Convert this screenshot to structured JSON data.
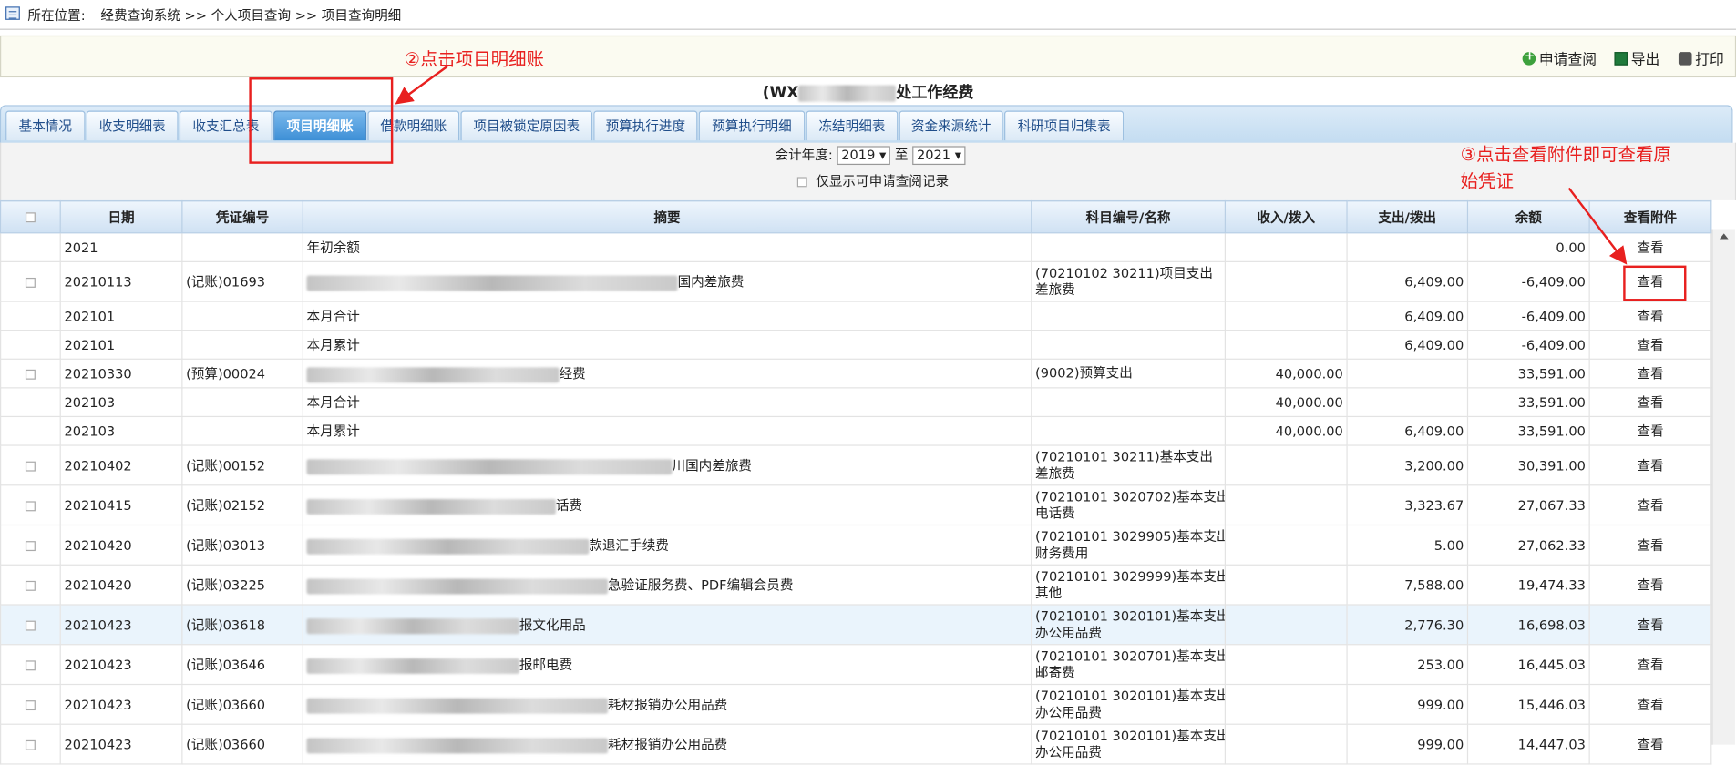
{
  "breadcrumb": {
    "label": "所在位置:",
    "path": "经费查询系统 >> 个人项目查询 >> 项目查询明细"
  },
  "toolbar": {
    "apply": "申请查阅",
    "export": "导出",
    "print": "打印"
  },
  "project_title": {
    "prefix": "(WX",
    "suffix": "处工作经费"
  },
  "tabs": [
    "基本情况",
    "收支明细表",
    "收支汇总表",
    "项目明细账",
    "借款明细账",
    "项目被锁定原因表",
    "预算执行进度",
    "预算执行明细",
    "冻结明细表",
    "资金来源统计",
    "科研项目归集表"
  ],
  "active_tab": "项目明细账",
  "filter": {
    "year_label": "会计年度:",
    "from": "2019",
    "to_label": "至",
    "to": "2021",
    "only_applicable": "仅显示可申请查阅记录"
  },
  "columns": [
    "日期",
    "凭证编号",
    "摘要",
    "科目编号/名称",
    "收入/拨入",
    "支出/拨出",
    "余额",
    "查看附件"
  ],
  "view_label": "查看",
  "rows": [
    {
      "date": "2021",
      "voucher": "",
      "summary": "年初余额",
      "subject": "",
      "income": "",
      "expense": "",
      "balance": "0.00",
      "check": false
    },
    {
      "date": "20210113",
      "voucher": "(记账)01693",
      "summary": "国内差旅费",
      "subject": "(70210102 30211)项目支出\n差旅费",
      "income": "",
      "expense": "6,409.00",
      "balance": "-6,409.00",
      "check": true
    },
    {
      "date": "202101",
      "voucher": "",
      "summary": "本月合计",
      "subject": "",
      "income": "",
      "expense": "6,409.00",
      "balance": "-6,409.00",
      "check": false
    },
    {
      "date": "202101",
      "voucher": "",
      "summary": "本月累计",
      "subject": "",
      "income": "",
      "expense": "6,409.00",
      "balance": "-6,409.00",
      "check": false
    },
    {
      "date": "20210330",
      "voucher": "(预算)00024",
      "summary": "经费",
      "subject": "(9002)预算支出",
      "income": "40,000.00",
      "expense": "",
      "balance": "33,591.00",
      "check": true
    },
    {
      "date": "202103",
      "voucher": "",
      "summary": "本月合计",
      "subject": "",
      "income": "40,000.00",
      "expense": "",
      "balance": "33,591.00",
      "check": false
    },
    {
      "date": "202103",
      "voucher": "",
      "summary": "本月累计",
      "subject": "",
      "income": "40,000.00",
      "expense": "6,409.00",
      "balance": "33,591.00",
      "check": false
    },
    {
      "date": "20210402",
      "voucher": "(记账)00152",
      "summary": "川国内差旅费",
      "subject": "(70210101 30211)基本支出\n差旅费",
      "income": "",
      "expense": "3,200.00",
      "balance": "30,391.00",
      "check": true
    },
    {
      "date": "20210415",
      "voucher": "(记账)02152",
      "summary": "话费",
      "subject": "(70210101 3020702)基本支出\n电话费",
      "income": "",
      "expense": "3,323.67",
      "balance": "27,067.33",
      "check": true
    },
    {
      "date": "20210420",
      "voucher": "(记账)03013",
      "summary": "款退汇手续费",
      "subject": "(70210101 3029905)基本支出\n财务费用",
      "income": "",
      "expense": "5.00",
      "balance": "27,062.33",
      "check": true
    },
    {
      "date": "20210420",
      "voucher": "(记账)03225",
      "summary": "急验证服务费、PDF编辑会员费",
      "subject": "(70210101 3029999)基本支出\n其他",
      "income": "",
      "expense": "7,588.00",
      "balance": "19,474.33",
      "check": true
    },
    {
      "date": "20210423",
      "voucher": "(记账)03618",
      "summary": "报文化用品",
      "subject": "(70210101 3020101)基本支出\n办公用品费",
      "income": "",
      "expense": "2,776.30",
      "balance": "16,698.03",
      "check": true
    },
    {
      "date": "20210423",
      "voucher": "(记账)03646",
      "summary": "报邮电费",
      "subject": "(70210101 3020701)基本支出\n邮寄费",
      "income": "",
      "expense": "253.00",
      "balance": "16,445.03",
      "check": true
    },
    {
      "date": "20210423",
      "voucher": "(记账)03660",
      "summary": "耗材报销办公用品费",
      "subject": "(70210101 3020101)基本支出\n办公用品费",
      "income": "",
      "expense": "999.00",
      "balance": "15,446.03",
      "check": true
    },
    {
      "date": "20210423",
      "voucher": "(记账)03660",
      "summary": "耗材报销办公用品费",
      "subject": "(70210101 3020101)基本支出\n办公用品费",
      "income": "",
      "expense": "999.00",
      "balance": "14,447.03",
      "check": true
    }
  ],
  "annotations": {
    "step2": "②点击项目明细账",
    "step3_line1": "③点击查看附件即可查看原",
    "step3_line2": "始凭证",
    "color": "#e8201f"
  }
}
